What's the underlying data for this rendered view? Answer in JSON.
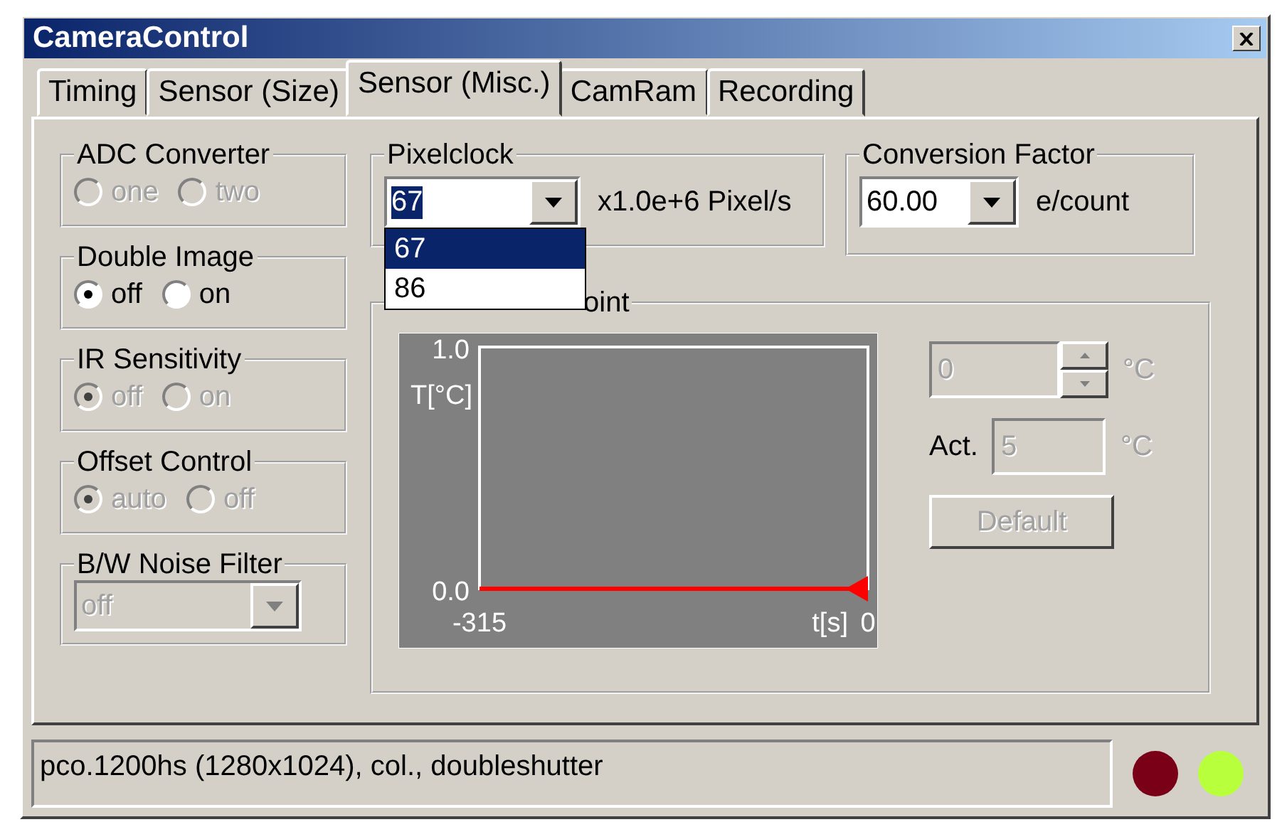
{
  "window": {
    "title": "CameraControl"
  },
  "tabs": [
    {
      "label": "Timing",
      "selected": false
    },
    {
      "label": "Sensor (Size)",
      "selected": false
    },
    {
      "label": "Sensor (Misc.)",
      "selected": true
    },
    {
      "label": "CamRam",
      "selected": false
    },
    {
      "label": "Recording",
      "selected": false
    }
  ],
  "left_groups": [
    {
      "kind": "radio",
      "title": "ADC Converter",
      "disabled": true,
      "options": [
        {
          "label": "one",
          "selected": false
        },
        {
          "label": "two",
          "selected": false
        }
      ]
    },
    {
      "kind": "radio",
      "title": "Double Image",
      "disabled": false,
      "options": [
        {
          "label": "off",
          "selected": true
        },
        {
          "label": "on",
          "selected": false
        }
      ]
    },
    {
      "kind": "radio",
      "title": "IR Sensitivity",
      "disabled": true,
      "options": [
        {
          "label": "off",
          "selected": true
        },
        {
          "label": "on",
          "selected": false
        }
      ]
    },
    {
      "kind": "radio",
      "title": "Offset Control",
      "disabled": true,
      "options": [
        {
          "label": "auto",
          "selected": true
        },
        {
          "label": "off",
          "selected": false
        }
      ]
    },
    {
      "kind": "combo",
      "title": "B/W Noise Filter",
      "disabled": true,
      "value": "off"
    }
  ],
  "pixelclock": {
    "title": "Pixelclock",
    "value": "67",
    "focused": true,
    "unit": "x1.0e+6 Pixel/s",
    "expanded": true,
    "options": [
      {
        "label": "67",
        "selected": true
      },
      {
        "label": "86",
        "selected": false
      }
    ]
  },
  "conversion_factor": {
    "title": "Conversion Factor",
    "value": "60.00",
    "unit": "e/count"
  },
  "setpoint": {
    "title": "oint",
    "chart_data": {
      "type": "line",
      "xlabel": "t[s]",
      "ylabel": "T[°C]",
      "x": [
        -315,
        0
      ],
      "series": [
        {
          "color": "#ff0000",
          "values": [
            0,
            0
          ]
        }
      ],
      "xlim": [
        -315,
        0
      ],
      "ylim": [
        0,
        1
      ],
      "xticks": [
        -315,
        0
      ],
      "yticks": [
        {
          "value": 0,
          "label": "0.0"
        },
        {
          "value": 1,
          "label": "1.0"
        }
      ]
    },
    "setpoint_field": {
      "value": "0",
      "disabled": true,
      "unit": "°C"
    },
    "actual": {
      "label": "Act.",
      "value": "5",
      "disabled": true,
      "unit": "°C"
    },
    "default_button": {
      "label": "Default",
      "disabled": true
    }
  },
  "status_bar": {
    "text": "pco.1200hs (1280x1024), col., doubleshutter",
    "leds": [
      {
        "color": "#7a0018"
      },
      {
        "color": "#b8ff3c"
      }
    ]
  }
}
